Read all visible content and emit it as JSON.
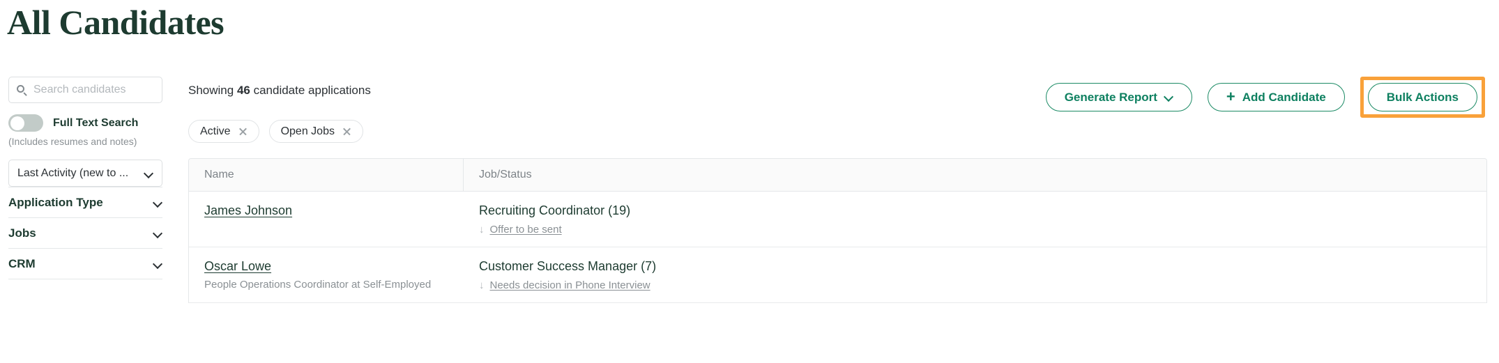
{
  "page": {
    "title": "All Candidates"
  },
  "sidebar": {
    "search": {
      "placeholder": "Search candidates",
      "value": "",
      "icon": "search-icon"
    },
    "full_text_search": {
      "label": "Full Text Search",
      "sublabel": "(Includes resumes and notes)",
      "enabled": false
    },
    "sort": {
      "value": "Last Activity (new to ...",
      "icon": "chevron-down-icon"
    },
    "filters": [
      {
        "label": "Application Type",
        "icon": "chevron-down-icon",
        "expanded": false
      },
      {
        "label": "Jobs",
        "icon": "chevron-down-icon",
        "expanded": false
      },
      {
        "label": "CRM",
        "icon": "chevron-down-icon",
        "expanded": false
      }
    ]
  },
  "toolbar": {
    "showing_prefix": "Showing ",
    "showing_count": "46",
    "showing_suffix": " candidate applications",
    "buttons": {
      "generate_report": "Generate Report",
      "add_candidate": "Add Candidate",
      "add_candidate_icon": "plus-icon",
      "bulk_actions": "Bulk Actions"
    },
    "highlight_color": "#f9a13a",
    "accent_color": "#0e8060"
  },
  "chips": [
    {
      "label": "Active",
      "remove_icon": "close-icon"
    },
    {
      "label": "Open Jobs",
      "remove_icon": "close-icon"
    }
  ],
  "table": {
    "columns": {
      "name": "Name",
      "job_status": "Job/Status"
    },
    "rows": [
      {
        "name": "James Johnson",
        "subtitle": "",
        "job": "Recruiting Coordinator (19)",
        "status": "Offer to be sent",
        "status_icon": "arrow-down-icon"
      },
      {
        "name": "Oscar Lowe",
        "subtitle": "People Operations Coordinator at Self-Employed",
        "job": "Customer Success Manager (7)",
        "status": "Needs decision in Phone Interview",
        "status_icon": "arrow-down-icon"
      }
    ]
  }
}
